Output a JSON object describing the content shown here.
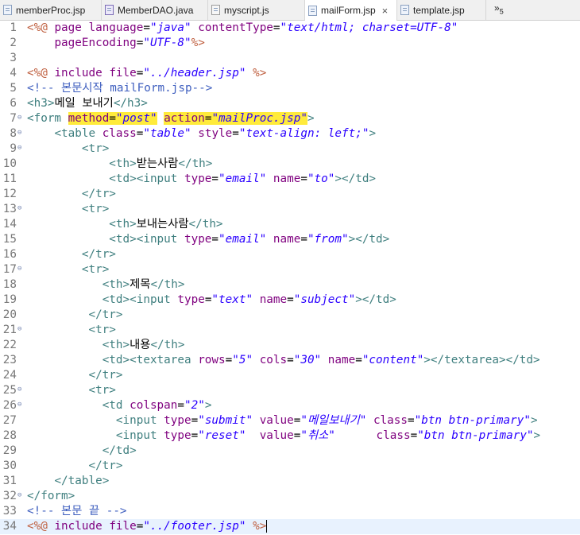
{
  "tabs": [
    {
      "label": "memberProc.jsp",
      "icon": "jsp-file-icon",
      "active": false
    },
    {
      "label": "MemberDAO.java",
      "icon": "java-file-icon",
      "active": false
    },
    {
      "label": "myscript.js",
      "icon": "js-file-icon",
      "active": false
    },
    {
      "label": "mailForm.jsp",
      "icon": "jsp-file-icon",
      "active": true
    },
    {
      "label": "template.jsp",
      "icon": "jsp-file-icon",
      "active": false
    }
  ],
  "tab_overflow": {
    "label": "»",
    "count": "5"
  },
  "colors": {
    "tag": "#3f7f7f",
    "attr": "#7f007f",
    "string": "#2a00ff",
    "delim": "#bf5f3f",
    "comment": "#3f5fbf",
    "text": "#000000",
    "highlight": "#ffeb3b"
  },
  "lines": [
    {
      "n": "1",
      "fold": false,
      "current": false,
      "tokens": [
        [
          "d",
          "<%@"
        ],
        [
          "x",
          " "
        ],
        [
          "a",
          "page"
        ],
        [
          "x",
          " "
        ],
        [
          "a",
          "language"
        ],
        [
          "x",
          "="
        ],
        [
          "s",
          "\"java\""
        ],
        [
          "x",
          " "
        ],
        [
          "a",
          "contentType"
        ],
        [
          "x",
          "="
        ],
        [
          "s",
          "\"text/html; charset=UTF-8\""
        ]
      ]
    },
    {
      "n": "2",
      "fold": false,
      "current": false,
      "tokens": [
        [
          "x",
          "    "
        ],
        [
          "a",
          "pageEncoding"
        ],
        [
          "x",
          "="
        ],
        [
          "s",
          "\"UTF-8\""
        ],
        [
          "d",
          "%>"
        ]
      ]
    },
    {
      "n": "3",
      "fold": false,
      "current": false,
      "tokens": []
    },
    {
      "n": "4",
      "fold": false,
      "current": false,
      "tokens": [
        [
          "d",
          "<%@"
        ],
        [
          "x",
          " "
        ],
        [
          "a",
          "include"
        ],
        [
          "x",
          " "
        ],
        [
          "a",
          "file"
        ],
        [
          "x",
          "="
        ],
        [
          "s",
          "\"../header.jsp\""
        ],
        [
          "x",
          " "
        ],
        [
          "d",
          "%>"
        ]
      ]
    },
    {
      "n": "5",
      "fold": false,
      "current": false,
      "tokens": [
        [
          "c",
          "<!-- 본문시작 mailForm.jsp-->"
        ]
      ]
    },
    {
      "n": "6",
      "fold": false,
      "current": false,
      "tokens": [
        [
          "t",
          "<h3>"
        ],
        [
          "x",
          "메일 보내기"
        ],
        [
          "t",
          "</h3>"
        ]
      ]
    },
    {
      "n": "7",
      "fold": true,
      "current": false,
      "tokens": [
        [
          "t",
          "<form"
        ],
        [
          "x",
          " "
        ],
        [
          "ah",
          "method"
        ],
        [
          "xh",
          "="
        ],
        [
          "sh",
          "\"post\""
        ],
        [
          "x",
          " "
        ],
        [
          "ah",
          "action"
        ],
        [
          "xh",
          "="
        ],
        [
          "sh",
          "\"mailProc.jsp\""
        ],
        [
          "t",
          ">"
        ]
      ]
    },
    {
      "n": "8",
      "fold": true,
      "current": false,
      "tokens": [
        [
          "x",
          "    "
        ],
        [
          "t",
          "<table"
        ],
        [
          "x",
          " "
        ],
        [
          "a",
          "class"
        ],
        [
          "x",
          "="
        ],
        [
          "s",
          "\"table\""
        ],
        [
          "x",
          " "
        ],
        [
          "a",
          "style"
        ],
        [
          "x",
          "="
        ],
        [
          "s",
          "\"text-align: "
        ],
        [
          "si",
          "left"
        ],
        [
          "s",
          ";\""
        ],
        [
          "t",
          ">"
        ]
      ]
    },
    {
      "n": "9",
      "fold": true,
      "current": false,
      "tokens": [
        [
          "x",
          "        "
        ],
        [
          "t",
          "<tr>"
        ]
      ]
    },
    {
      "n": "10",
      "fold": false,
      "current": false,
      "tokens": [
        [
          "x",
          "            "
        ],
        [
          "t",
          "<th>"
        ],
        [
          "x",
          "받는사람"
        ],
        [
          "t",
          "</th>"
        ]
      ]
    },
    {
      "n": "11",
      "fold": false,
      "current": false,
      "tokens": [
        [
          "x",
          "            "
        ],
        [
          "t",
          "<td><input"
        ],
        [
          "x",
          " "
        ],
        [
          "a",
          "type"
        ],
        [
          "x",
          "="
        ],
        [
          "s",
          "\"email\""
        ],
        [
          "x",
          " "
        ],
        [
          "a",
          "name"
        ],
        [
          "x",
          "="
        ],
        [
          "s",
          "\"to\""
        ],
        [
          "t",
          "></td>"
        ]
      ]
    },
    {
      "n": "12",
      "fold": false,
      "current": false,
      "tokens": [
        [
          "x",
          "        "
        ],
        [
          "t",
          "</tr>"
        ]
      ]
    },
    {
      "n": "13",
      "fold": true,
      "current": false,
      "tokens": [
        [
          "x",
          "        "
        ],
        [
          "t",
          "<tr>"
        ]
      ]
    },
    {
      "n": "14",
      "fold": false,
      "current": false,
      "tokens": [
        [
          "x",
          "            "
        ],
        [
          "t",
          "<th>"
        ],
        [
          "x",
          "보내는사람"
        ],
        [
          "t",
          "</th>"
        ]
      ]
    },
    {
      "n": "15",
      "fold": false,
      "current": false,
      "tokens": [
        [
          "x",
          "            "
        ],
        [
          "t",
          "<td><input"
        ],
        [
          "x",
          " "
        ],
        [
          "a",
          "type"
        ],
        [
          "x",
          "="
        ],
        [
          "s",
          "\"email\""
        ],
        [
          "x",
          " "
        ],
        [
          "a",
          "name"
        ],
        [
          "x",
          "="
        ],
        [
          "s",
          "\"from\""
        ],
        [
          "t",
          "></td>"
        ]
      ]
    },
    {
      "n": "16",
      "fold": false,
      "current": false,
      "tokens": [
        [
          "x",
          "        "
        ],
        [
          "t",
          "</tr>"
        ]
      ]
    },
    {
      "n": "17",
      "fold": true,
      "current": false,
      "tokens": [
        [
          "x",
          "        "
        ],
        [
          "t",
          "<tr>"
        ]
      ]
    },
    {
      "n": "18",
      "fold": false,
      "current": false,
      "tokens": [
        [
          "x",
          "           "
        ],
        [
          "t",
          "<th>"
        ],
        [
          "x",
          "제목"
        ],
        [
          "t",
          "</th>"
        ]
      ]
    },
    {
      "n": "19",
      "fold": false,
      "current": false,
      "tokens": [
        [
          "x",
          "           "
        ],
        [
          "t",
          "<td><input"
        ],
        [
          "x",
          " "
        ],
        [
          "a",
          "type"
        ],
        [
          "x",
          "="
        ],
        [
          "s",
          "\"text\""
        ],
        [
          "x",
          " "
        ],
        [
          "a",
          "name"
        ],
        [
          "x",
          "="
        ],
        [
          "s",
          "\"subject\""
        ],
        [
          "t",
          "></td>"
        ]
      ]
    },
    {
      "n": "20",
      "fold": false,
      "current": false,
      "tokens": [
        [
          "x",
          "         "
        ],
        [
          "t",
          "</tr>"
        ]
      ]
    },
    {
      "n": "21",
      "fold": true,
      "current": false,
      "tokens": [
        [
          "x",
          "         "
        ],
        [
          "t",
          "<tr>"
        ]
      ]
    },
    {
      "n": "22",
      "fold": false,
      "current": false,
      "tokens": [
        [
          "x",
          "           "
        ],
        [
          "t",
          "<th>"
        ],
        [
          "x",
          "내용"
        ],
        [
          "t",
          "</th>"
        ]
      ]
    },
    {
      "n": "23",
      "fold": false,
      "current": false,
      "tokens": [
        [
          "x",
          "           "
        ],
        [
          "t",
          "<td><textarea"
        ],
        [
          "x",
          " "
        ],
        [
          "a",
          "rows"
        ],
        [
          "x",
          "="
        ],
        [
          "s",
          "\"5\""
        ],
        [
          "x",
          " "
        ],
        [
          "a",
          "cols"
        ],
        [
          "x",
          "="
        ],
        [
          "s",
          "\"30\""
        ],
        [
          "x",
          " "
        ],
        [
          "a",
          "name"
        ],
        [
          "x",
          "="
        ],
        [
          "s",
          "\"content\""
        ],
        [
          "t",
          "></textarea></td>"
        ]
      ]
    },
    {
      "n": "24",
      "fold": false,
      "current": false,
      "tokens": [
        [
          "x",
          "         "
        ],
        [
          "t",
          "</tr>"
        ]
      ]
    },
    {
      "n": "25",
      "fold": true,
      "current": false,
      "tokens": [
        [
          "x",
          "         "
        ],
        [
          "t",
          "<tr>"
        ]
      ]
    },
    {
      "n": "26",
      "fold": true,
      "current": false,
      "tokens": [
        [
          "x",
          "           "
        ],
        [
          "t",
          "<td"
        ],
        [
          "x",
          " "
        ],
        [
          "a",
          "colspan"
        ],
        [
          "x",
          "="
        ],
        [
          "s",
          "\"2\""
        ],
        [
          "t",
          ">"
        ]
      ]
    },
    {
      "n": "27",
      "fold": false,
      "current": false,
      "tokens": [
        [
          "x",
          "             "
        ],
        [
          "t",
          "<input"
        ],
        [
          "x",
          " "
        ],
        [
          "a",
          "type"
        ],
        [
          "x",
          "="
        ],
        [
          "s",
          "\"submit\""
        ],
        [
          "x",
          " "
        ],
        [
          "a",
          "value"
        ],
        [
          "x",
          "="
        ],
        [
          "s",
          "\"메일보내기\""
        ],
        [
          "x",
          " "
        ],
        [
          "a",
          "class"
        ],
        [
          "x",
          "="
        ],
        [
          "s",
          "\"btn btn-primary\""
        ],
        [
          "t",
          ">"
        ]
      ]
    },
    {
      "n": "28",
      "fold": false,
      "current": false,
      "tokens": [
        [
          "x",
          "             "
        ],
        [
          "t",
          "<input"
        ],
        [
          "x",
          " "
        ],
        [
          "a",
          "type"
        ],
        [
          "x",
          "="
        ],
        [
          "s",
          "\"reset\""
        ],
        [
          "x",
          "  "
        ],
        [
          "a",
          "value"
        ],
        [
          "x",
          "="
        ],
        [
          "s",
          "\"취소\""
        ],
        [
          "x",
          "      "
        ],
        [
          "a",
          "class"
        ],
        [
          "x",
          "="
        ],
        [
          "s",
          "\"btn btn-primary\""
        ],
        [
          "t",
          ">"
        ]
      ]
    },
    {
      "n": "29",
      "fold": false,
      "current": false,
      "tokens": [
        [
          "x",
          "           "
        ],
        [
          "t",
          "</td>"
        ]
      ]
    },
    {
      "n": "30",
      "fold": false,
      "current": false,
      "tokens": [
        [
          "x",
          "         "
        ],
        [
          "t",
          "</tr>"
        ]
      ]
    },
    {
      "n": "31",
      "fold": false,
      "current": false,
      "tokens": [
        [
          "x",
          "    "
        ],
        [
          "t",
          "</table>"
        ]
      ]
    },
    {
      "n": "32",
      "fold": true,
      "current": false,
      "tokens": [
        [
          "t",
          "</form>"
        ]
      ]
    },
    {
      "n": "33",
      "fold": false,
      "current": false,
      "tokens": [
        [
          "c",
          "<!-- 본문 끝 -->"
        ]
      ]
    },
    {
      "n": "34",
      "fold": false,
      "current": true,
      "tokens": [
        [
          "d",
          "<%@"
        ],
        [
          "x",
          " "
        ],
        [
          "a",
          "include"
        ],
        [
          "x",
          " "
        ],
        [
          "a",
          "file"
        ],
        [
          "x",
          "="
        ],
        [
          "s",
          "\"../footer.jsp\""
        ],
        [
          "x",
          " "
        ],
        [
          "d",
          "%>"
        ]
      ]
    }
  ]
}
